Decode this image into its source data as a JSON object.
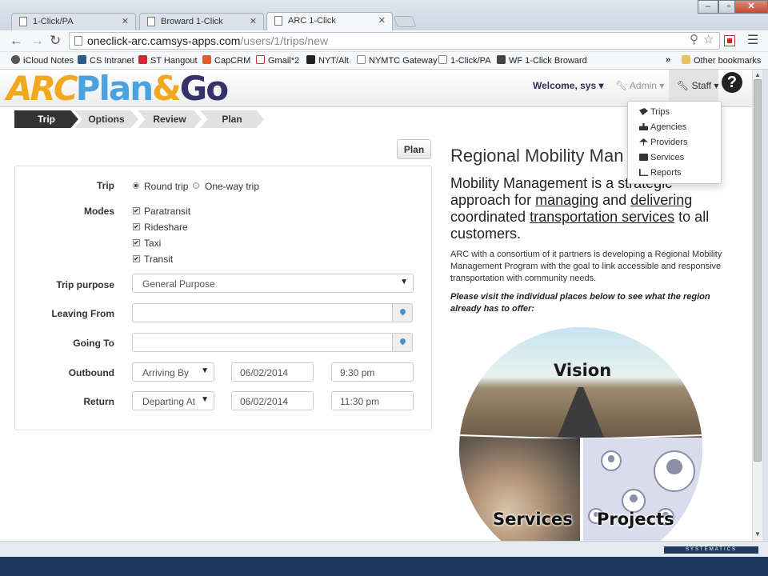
{
  "browser": {
    "tabs": [
      {
        "title": "1-Click/PA"
      },
      {
        "title": "Broward 1-Click"
      },
      {
        "title": "ARC 1-Click"
      }
    ],
    "url_host": "oneclick-arc.camsys-apps.com",
    "url_path": "/users/1/trips/new",
    "bookmarks": [
      "iCloud Notes",
      "CS Intranet",
      "ST Hangout",
      "CapCRM",
      "Gmail*2",
      "NYT/Alt",
      "NYMTC Gateway",
      "1-Click/PA",
      "WF 1-Click Broward"
    ],
    "bookmarks_overflow": "»",
    "other_bookmarks": "Other bookmarks"
  },
  "header": {
    "logo": {
      "arc": "ARC",
      "plan": "Plan",
      "amp": "&",
      "go": "Go"
    },
    "welcome": "Welcome, sys ▾",
    "admin": "Admin ▾",
    "staff": "Staff ▾",
    "help": "?"
  },
  "staff_menu": [
    "Trips",
    "Agencies",
    "Providers",
    "Services",
    "Reports"
  ],
  "steps": [
    "Trip",
    "Options",
    "Review",
    "Plan"
  ],
  "plan_button": "Plan",
  "form": {
    "trip_label": "Trip",
    "trip_options": [
      "Round trip",
      "One-way trip"
    ],
    "modes_label": "Modes",
    "modes": [
      "Paratransit",
      "Rideshare",
      "Taxi",
      "Transit"
    ],
    "purpose_label": "Trip purpose",
    "purpose_value": "General Purpose",
    "leaving_label": "Leaving From",
    "going_label": "Going To",
    "outbound_label": "Outbound",
    "outbound_type": "Arriving By",
    "outbound_date": "06/02/2014",
    "outbound_time": "9:30 pm",
    "return_label": "Return",
    "return_type": "Departing At",
    "return_date": "06/02/2014",
    "return_time": "11:30 pm"
  },
  "content": {
    "title": "Regional Mobility Man",
    "lead_1": "Mobility Management is a strategic approach for ",
    "lead_link_1": "managing",
    "lead_2": " and ",
    "lead_link_2": "delivering",
    "lead_3": " coordinated ",
    "lead_link_3": "transportation services",
    "lead_4": " to all customers.",
    "body": "ARC with a consortium of it partners is developing  a Regional Mobility Management Program with the goal to link accessible and responsive transportation with community needs.",
    "visit": "Please visit the individual places below to see what the region already has to offer:",
    "circle_labels": [
      "Vision",
      "Services",
      "Projects"
    ]
  },
  "footer_brand": "SYSTEMATICS"
}
